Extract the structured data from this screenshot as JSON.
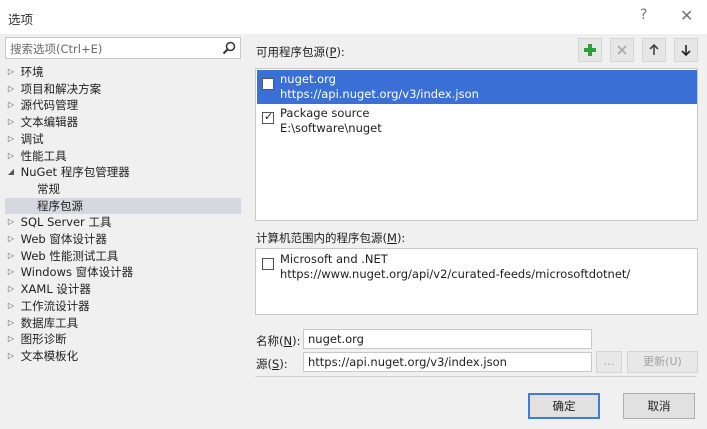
{
  "window": {
    "title": "选项",
    "help_glyph": "?",
    "close_glyph": "✕"
  },
  "search": {
    "placeholder": "搜索选项(Ctrl+E)"
  },
  "tree": [
    {
      "label": "环境",
      "level": 0,
      "arrow": "▷"
    },
    {
      "label": "项目和解决方案",
      "level": 0,
      "arrow": "▷"
    },
    {
      "label": "源代码管理",
      "level": 0,
      "arrow": "▷"
    },
    {
      "label": "文本编辑器",
      "level": 0,
      "arrow": "▷"
    },
    {
      "label": "调试",
      "level": 0,
      "arrow": "▷"
    },
    {
      "label": "性能工具",
      "level": 0,
      "arrow": "▷"
    },
    {
      "label": "NuGet 程序包管理器",
      "level": 0,
      "arrow": "◢"
    },
    {
      "label": "常规",
      "level": 1,
      "arrow": ""
    },
    {
      "label": "程序包源",
      "level": 1,
      "arrow": "",
      "selected": true
    },
    {
      "label": "SQL Server 工具",
      "level": 0,
      "arrow": "▷"
    },
    {
      "label": "Web 窗体设计器",
      "level": 0,
      "arrow": "▷"
    },
    {
      "label": "Web 性能测试工具",
      "level": 0,
      "arrow": "▷"
    },
    {
      "label": "Windows 窗体设计器",
      "level": 0,
      "arrow": "▷"
    },
    {
      "label": "XAML 设计器",
      "level": 0,
      "arrow": "▷"
    },
    {
      "label": "工作流设计器",
      "level": 0,
      "arrow": "▷"
    },
    {
      "label": "数据库工具",
      "level": 0,
      "arrow": "▷"
    },
    {
      "label": "图形诊断",
      "level": 0,
      "arrow": "▷"
    },
    {
      "label": "文本模板化",
      "level": 0,
      "arrow": "▷"
    }
  ],
  "available": {
    "label_prefix": "可用程序包源(",
    "label_key": "P",
    "label_suffix": "):",
    "sources": [
      {
        "name": "nuget.org",
        "url": "https://api.nuget.org/v3/index.json",
        "checked": false,
        "selected": true
      },
      {
        "name": "Package source",
        "url": "E:\\software\\nuget",
        "checked": true,
        "selected": false
      }
    ]
  },
  "toolbar": {
    "add_icon": "plus-icon",
    "remove_icon": "x-icon",
    "up_icon": "arrow-up-icon",
    "down_icon": "arrow-down-icon",
    "add_color": "#2e9e3a"
  },
  "machine": {
    "label_prefix": "计算机范围内的程序包源(",
    "label_key": "M",
    "label_suffix": "):",
    "sources": [
      {
        "name": "Microsoft and .NET",
        "url": "https://www.nuget.org/api/v2/curated-feeds/microsoftdotnet/",
        "checked": false
      }
    ]
  },
  "form": {
    "name_label_prefix": "名称(",
    "name_label_key": "N",
    "name_label_suffix": "):",
    "name_value": "nuget.org",
    "source_label_prefix": "源(",
    "source_label_key": "S",
    "source_label_suffix": "):",
    "source_value": "https://api.nuget.org/v3/index.json",
    "browse_label": "...",
    "update_label": "更新(U)"
  },
  "footer": {
    "ok_label": "确定",
    "cancel_label": "取消"
  },
  "colors": {
    "selection": "#3a6fd6",
    "accent": "#3c7fd4"
  }
}
